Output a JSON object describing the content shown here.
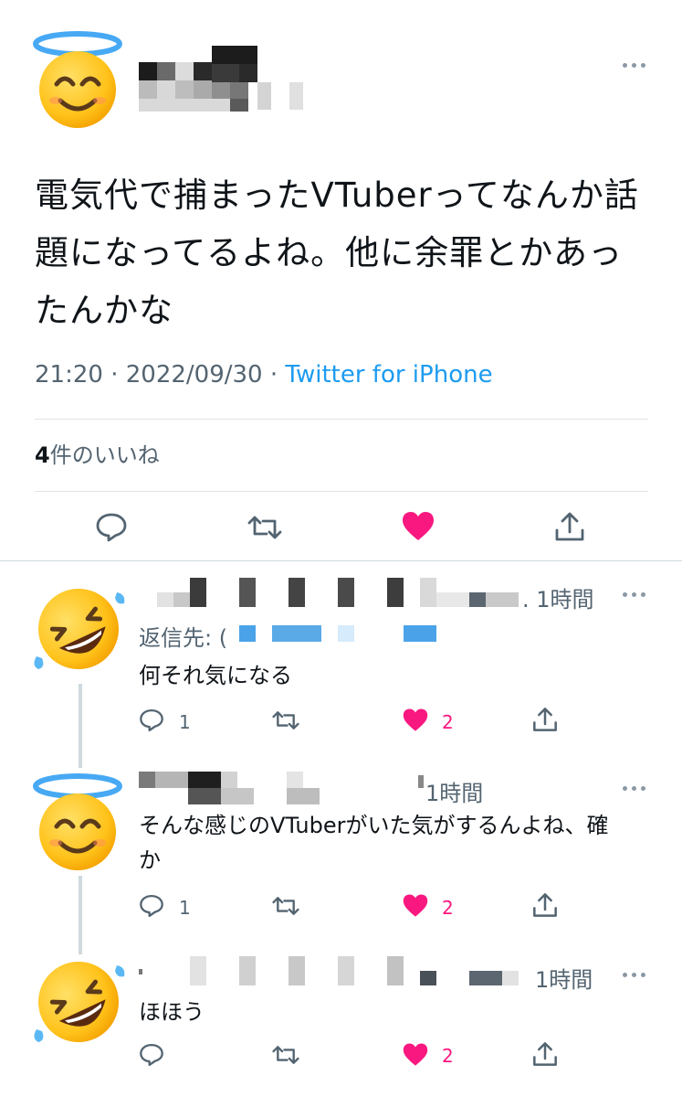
{
  "main_tweet": {
    "text": "電気代で捕まったVTuberってなんか話題になってるよね。他に余罪とかあったんかな",
    "time": "21:20",
    "date": "2022/09/30",
    "source": "Twitter for iPhone",
    "likes_count": "4",
    "likes_label": "件のいいね"
  },
  "replies": [
    {
      "time": "1時間",
      "reply_to_label": "返信先: (",
      "text": "何それ気になる",
      "reply_count": "1",
      "like_count": "2"
    },
    {
      "time": "1時間",
      "text": "そんな感じのVTuberがいた気がするんよね、確か",
      "reply_count": "1",
      "like_count": "2"
    },
    {
      "time": "1時間",
      "text": "ほほう",
      "like_count": "2"
    }
  ],
  "colors": {
    "accent": "#1d9bf0",
    "like": "#f91880",
    "secondary_text": "#536471"
  }
}
